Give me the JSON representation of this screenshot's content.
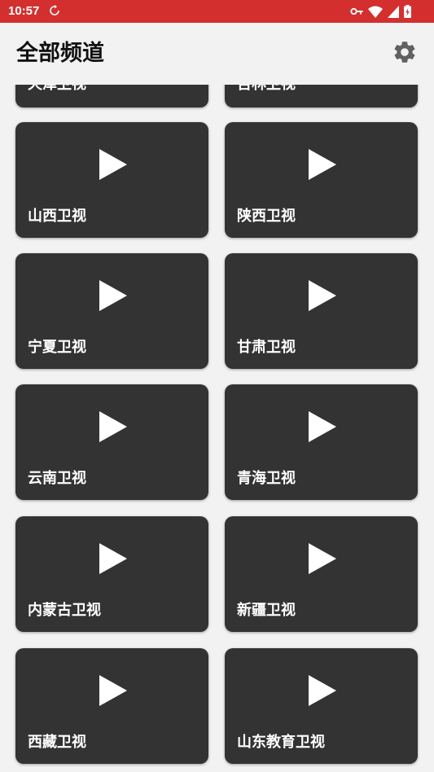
{
  "status_bar": {
    "time": "10:57",
    "background": "#d32f2f",
    "icons": [
      "sync-icon",
      "vpn-key-icon",
      "wifi-icon",
      "signal-icon",
      "battery-charging-icon"
    ]
  },
  "header": {
    "title": "全部频道",
    "settings_icon": "gear-icon"
  },
  "channels": [
    {
      "name": "天津卫视"
    },
    {
      "name": "吉林卫视"
    },
    {
      "name": "山西卫视"
    },
    {
      "name": "陕西卫视"
    },
    {
      "name": "宁夏卫视"
    },
    {
      "name": "甘肃卫视"
    },
    {
      "name": "云南卫视"
    },
    {
      "name": "青海卫视"
    },
    {
      "name": "内蒙古卫视"
    },
    {
      "name": "新疆卫视"
    },
    {
      "name": "西藏卫视"
    },
    {
      "name": "山东教育卫视"
    }
  ],
  "colors": {
    "accent": "#d32f2f",
    "card_background": "#333333",
    "page_background": "#f2f2f2",
    "card_text": "#ffffff"
  }
}
